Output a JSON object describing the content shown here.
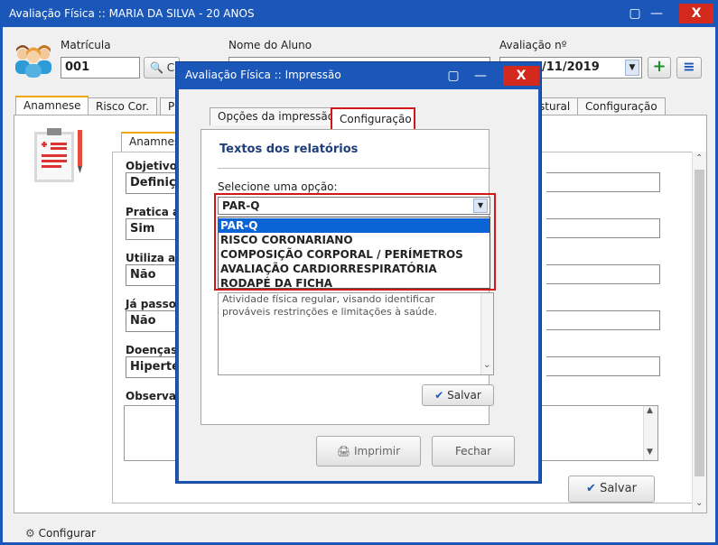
{
  "main": {
    "title": "Avaliação Física  ::  MARIA DA SILVA  -  20 ANOS",
    "min_label": "—",
    "close_label": "X",
    "matricula_label": "Matrícula",
    "matricula_value": "001",
    "search_button": "C",
    "nome_label": "Nome do Aluno",
    "avaliacao_label": "Avaliação nº",
    "avaliacao_date": "/11/2019",
    "add_button": "+",
    "menu_button": "≡",
    "tabs": [
      "Anamnese",
      "Risco Cor.",
      "P",
      "stural",
      "Configuração"
    ],
    "subtab": "Anamnes",
    "fields": [
      {
        "label": "Objetivos",
        "value": "Definiçã"
      },
      {
        "label": "Pratica ati",
        "value": "Sim"
      },
      {
        "label": "Utiliza algu",
        "value": "Não"
      },
      {
        "label": "Já passou",
        "value": "Não"
      },
      {
        "label": "Doenças n",
        "value": "Hiperten"
      }
    ],
    "observacoes_label": "Observaçõ",
    "configurar_label": "Configurar",
    "salvar_label": "Salvar"
  },
  "dialog": {
    "title": "Avaliação Física :: Impressão",
    "min_label": "—",
    "close_label": "X",
    "tabs": [
      "Opções da impressão",
      "Configuração"
    ],
    "heading": "Textos dos relatórios",
    "select_label": "Selecione uma opção:",
    "selected_option": "PAR-Q",
    "options": [
      "PAR-Q",
      "RISCO CORONARIANO",
      "COMPOSIÇÃO CORPORAL / PERÍMETROS",
      "AVALIAÇÃO CARDIORRESPIRATÓRIA",
      "RODAPÉ DA FICHA"
    ],
    "text_content": "Atividade física regular, visando identificar prováveis restrinções e limitações à saúde.",
    "salvar_label": "Salvar",
    "imprimir_label": "Imprimir",
    "fechar_label": "Fechar"
  },
  "colors": {
    "title_bar": "#1a57b8",
    "close": "#d42a1e",
    "highlight": "#d01818",
    "selection": "#0a64d6"
  }
}
